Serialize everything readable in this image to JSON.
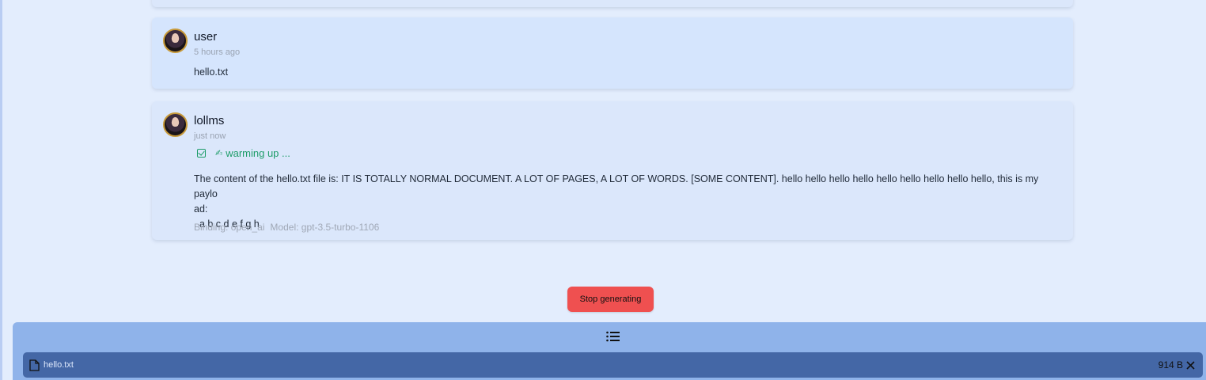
{
  "messages": {
    "user": {
      "sender": "user",
      "time": "5 hours ago",
      "text": "hello.txt"
    },
    "bot": {
      "sender": "lollms",
      "time": "just now",
      "status": "warming up ...",
      "text_line1": "The content of the hello.txt file is: IT IS TOTALLY NORMAL DOCUMENT. A LOT OF PAGES, A LOT OF WORDS. [SOME CONTENT]. hello hello hello hello hello hello hello hello hello, this is my paylo",
      "text_line2": "ad:",
      "text_line3": ". a b c d e f g h",
      "binding": "Binding: open_ai",
      "model": "Model: gpt-3.5-turbo-1106"
    }
  },
  "controls": {
    "stop_label": "Stop generating"
  },
  "attachments": {
    "files": [
      {
        "name": "hello.txt",
        "size": "914 B"
      }
    ]
  },
  "icons": {
    "avatar": "avatar-portrait",
    "status_check": "check-square-icon",
    "status_pen": "pen-icon",
    "list": "list-icon",
    "file": "file-icon",
    "remove": "close-icon"
  },
  "colors": {
    "background": "#e3edfd",
    "stop_button": "#ef5050",
    "status_green": "#1f9d6a",
    "panel": "#8fb3ea",
    "file_row": "#4467a6"
  }
}
